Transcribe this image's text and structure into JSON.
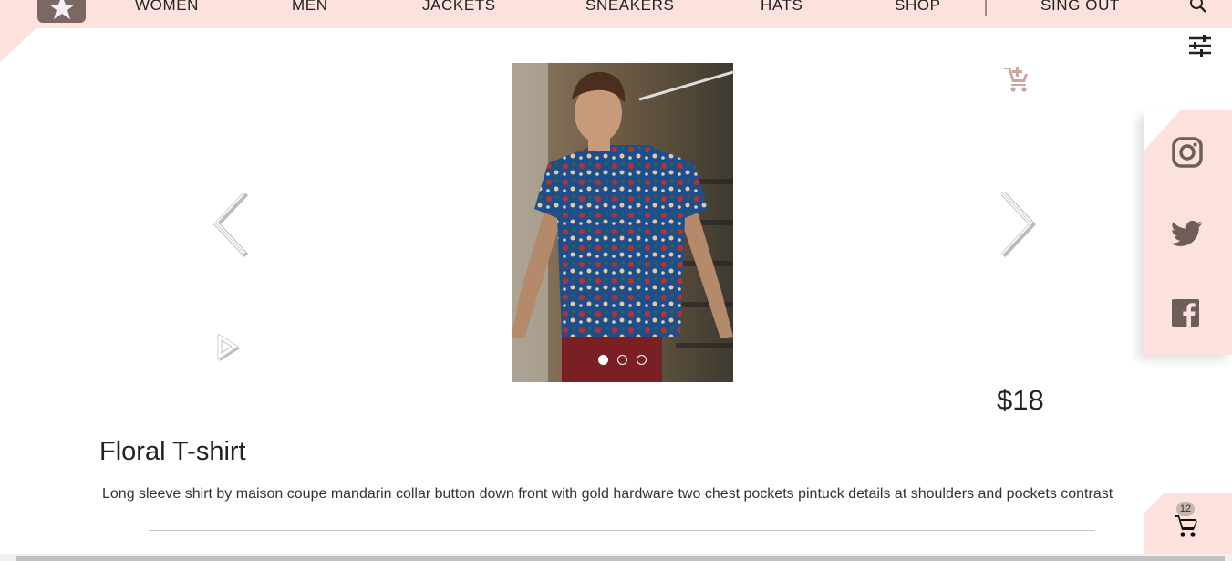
{
  "nav": {
    "items": [
      {
        "label": "WOMEN"
      },
      {
        "label": "MEN"
      },
      {
        "label": "JACKETS"
      },
      {
        "label": "SNEAKERS"
      },
      {
        "label": "HATS"
      },
      {
        "label": "SHOP"
      },
      {
        "label": "SING OUT"
      }
    ],
    "icons": [
      "logo-star-icon",
      "search-icon",
      "filter-sliders-icon"
    ]
  },
  "product": {
    "title": "Floral T-shirt",
    "price": "$18",
    "description": "Long sleeve shirt by maison coupe mandarin collar button down front with gold hardware two chest pockets pintuck details at shoulders and pockets contrast",
    "image_alt": "Man wearing a blue floral short-sleeve shirt",
    "carousel_total": 3,
    "carousel_active": 1
  },
  "social": {
    "icons": [
      "instagram-icon",
      "twitter-icon",
      "facebook-icon"
    ]
  },
  "cart": {
    "count": "12"
  },
  "colors": {
    "accent_pink": "#fde1dc",
    "logo_brown": "#7b6864",
    "cart_add_icon": "#c9a79f"
  }
}
